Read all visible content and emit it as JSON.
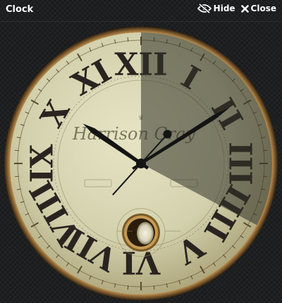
{
  "window": {
    "title": "Clock"
  },
  "actions": {
    "hide_label": "Hide",
    "close_label": "Close",
    "hide_icon": "eye-slash-icon",
    "close_icon": "close-icon"
  },
  "clock": {
    "brand": "Harrison Gray",
    "time": {
      "hours": 10,
      "minutes": 9,
      "seconds": 37
    },
    "numerals": [
      "XII",
      "I",
      "II",
      "III",
      "IIII",
      "V",
      "VI",
      "VII",
      "VIII",
      "IX",
      "X",
      "XI"
    ],
    "colors": {
      "face": "#d9d8b5",
      "numerals": "#2a2420",
      "hands": "#141414",
      "rim": "#8a6a3a",
      "overlay": "#3d3f33"
    }
  }
}
